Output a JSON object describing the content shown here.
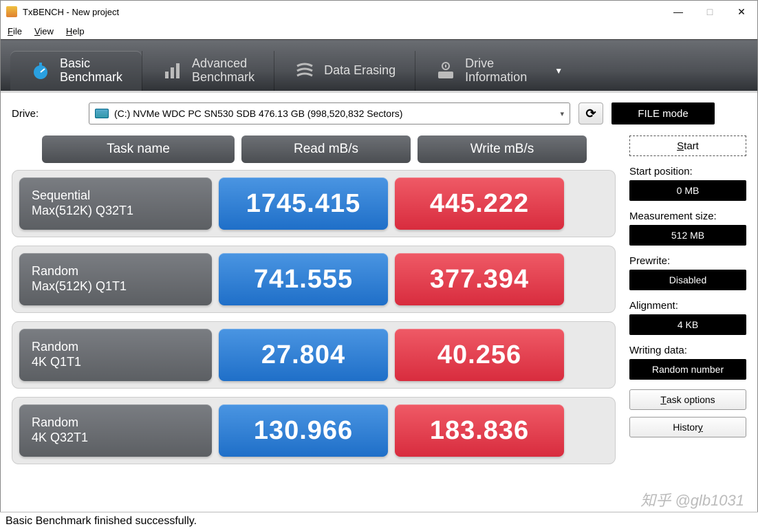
{
  "window": {
    "title": "TxBENCH - New project"
  },
  "menu": {
    "file": "File",
    "view": "View",
    "help": "Help"
  },
  "tabs": {
    "basic": "Basic\nBenchmark",
    "advanced": "Advanced\nBenchmark",
    "erasing": "Data Erasing",
    "drive": "Drive\nInformation"
  },
  "drive": {
    "label": "Drive:",
    "selected": "(C:) NVMe WDC PC SN530 SDB  476.13 GB (998,520,832 Sectors)",
    "filemode": "FILE mode"
  },
  "headers": {
    "task": "Task name",
    "read": "Read mB/s",
    "write": "Write mB/s"
  },
  "rows": [
    {
      "name1": "Sequential",
      "name2": "Max(512K) Q32T1",
      "read": "1745.415",
      "write": "445.222"
    },
    {
      "name1": "Random",
      "name2": "Max(512K) Q1T1",
      "read": "741.555",
      "write": "377.394"
    },
    {
      "name1": "Random",
      "name2": "4K Q1T1",
      "read": "27.804",
      "write": "40.256"
    },
    {
      "name1": "Random",
      "name2": "4K Q32T1",
      "read": "130.966",
      "write": "183.836"
    }
  ],
  "sidebar": {
    "start": "Start",
    "start_pos_label": "Start position:",
    "start_pos_value": "0 MB",
    "meas_label": "Measurement size:",
    "meas_value": "512 MB",
    "prewrite_label": "Prewrite:",
    "prewrite_value": "Disabled",
    "align_label": "Alignment:",
    "align_value": "4 KB",
    "wdata_label": "Writing data:",
    "wdata_value": "Random number",
    "task_options": "Task options",
    "history": "History"
  },
  "status": "Basic Benchmark finished successfully.",
  "watermark": "知乎 @glb1031",
  "chart_data": {
    "type": "table",
    "title": "Basic Benchmark",
    "columns": [
      "Task name",
      "Read mB/s",
      "Write mB/s"
    ],
    "rows": [
      [
        "Sequential Max(512K) Q32T1",
        1745.415,
        445.222
      ],
      [
        "Random Max(512K) Q1T1",
        741.555,
        377.394
      ],
      [
        "Random 4K Q1T1",
        27.804,
        40.256
      ],
      [
        "Random 4K Q32T1",
        130.966,
        183.836
      ]
    ]
  }
}
